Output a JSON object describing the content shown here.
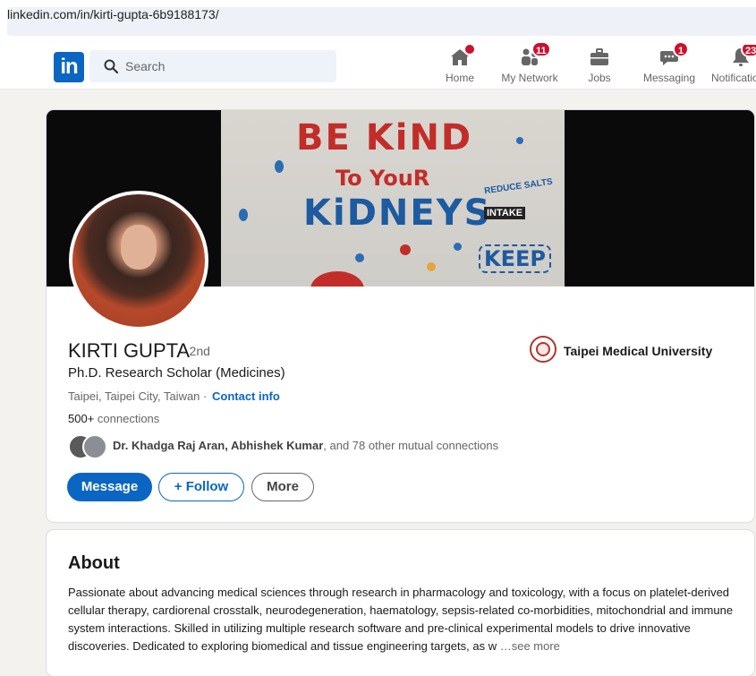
{
  "browser": {
    "url": "linkedin.com/in/kirti-gupta-6b9188173/"
  },
  "nav": {
    "logo_text": "in",
    "search_placeholder": "Search",
    "items": [
      {
        "label": "Home",
        "icon": "home-icon",
        "badge": ""
      },
      {
        "label": "My Network",
        "icon": "network-icon",
        "badge": "11"
      },
      {
        "label": "Jobs",
        "icon": "briefcase-icon",
        "badge": ""
      },
      {
        "label": "Messaging",
        "icon": "messaging-icon",
        "badge": "1"
      },
      {
        "label": "Notificatio",
        "icon": "bell-icon",
        "badge": "23"
      }
    ]
  },
  "banner": {
    "line1": "BE KiND",
    "line2": "To YouR",
    "line3": "KiDNEYS",
    "tag1": "INTAKE",
    "tag2": "REDUCE SALTS",
    "tag3": "KEEP"
  },
  "profile": {
    "name": "KIRTI GUPTA",
    "degree": "· 2nd",
    "headline": "Ph.D. Research Scholar (Medicines)",
    "location": "Taipei, Taipei City, Taiwan ·",
    "contact_info": "Contact info",
    "connections_count": "500+",
    "connections_label": " connections",
    "mutual_names": "Dr. Khadga Raj Aran, Abhishek Kumar",
    "mutual_rest": ", and 78 other mutual connections",
    "university": "Taipei Medical University"
  },
  "actions": {
    "message": "Message",
    "follow": "+ Follow",
    "more": "More"
  },
  "about": {
    "heading": "About",
    "text": "Passionate about advancing medical sciences through research in pharmacology and toxicology, with a focus on platelet-derived cellular therapy, cardiorenal crosstalk, neurodegeneration, haematology, sepsis-related co-morbidities, mitochondrial and immune system interactions. Skilled in utilizing multiple research software and pre-clinical experimental models to drive innovative discoveries. Dedicated to exploring biomedical and tissue engineering targets, as w",
    "see_more": " …see more"
  },
  "colors": {
    "brand": "#0a66c2",
    "badge": "#cb112d",
    "page_bg": "#f4f2ee"
  }
}
